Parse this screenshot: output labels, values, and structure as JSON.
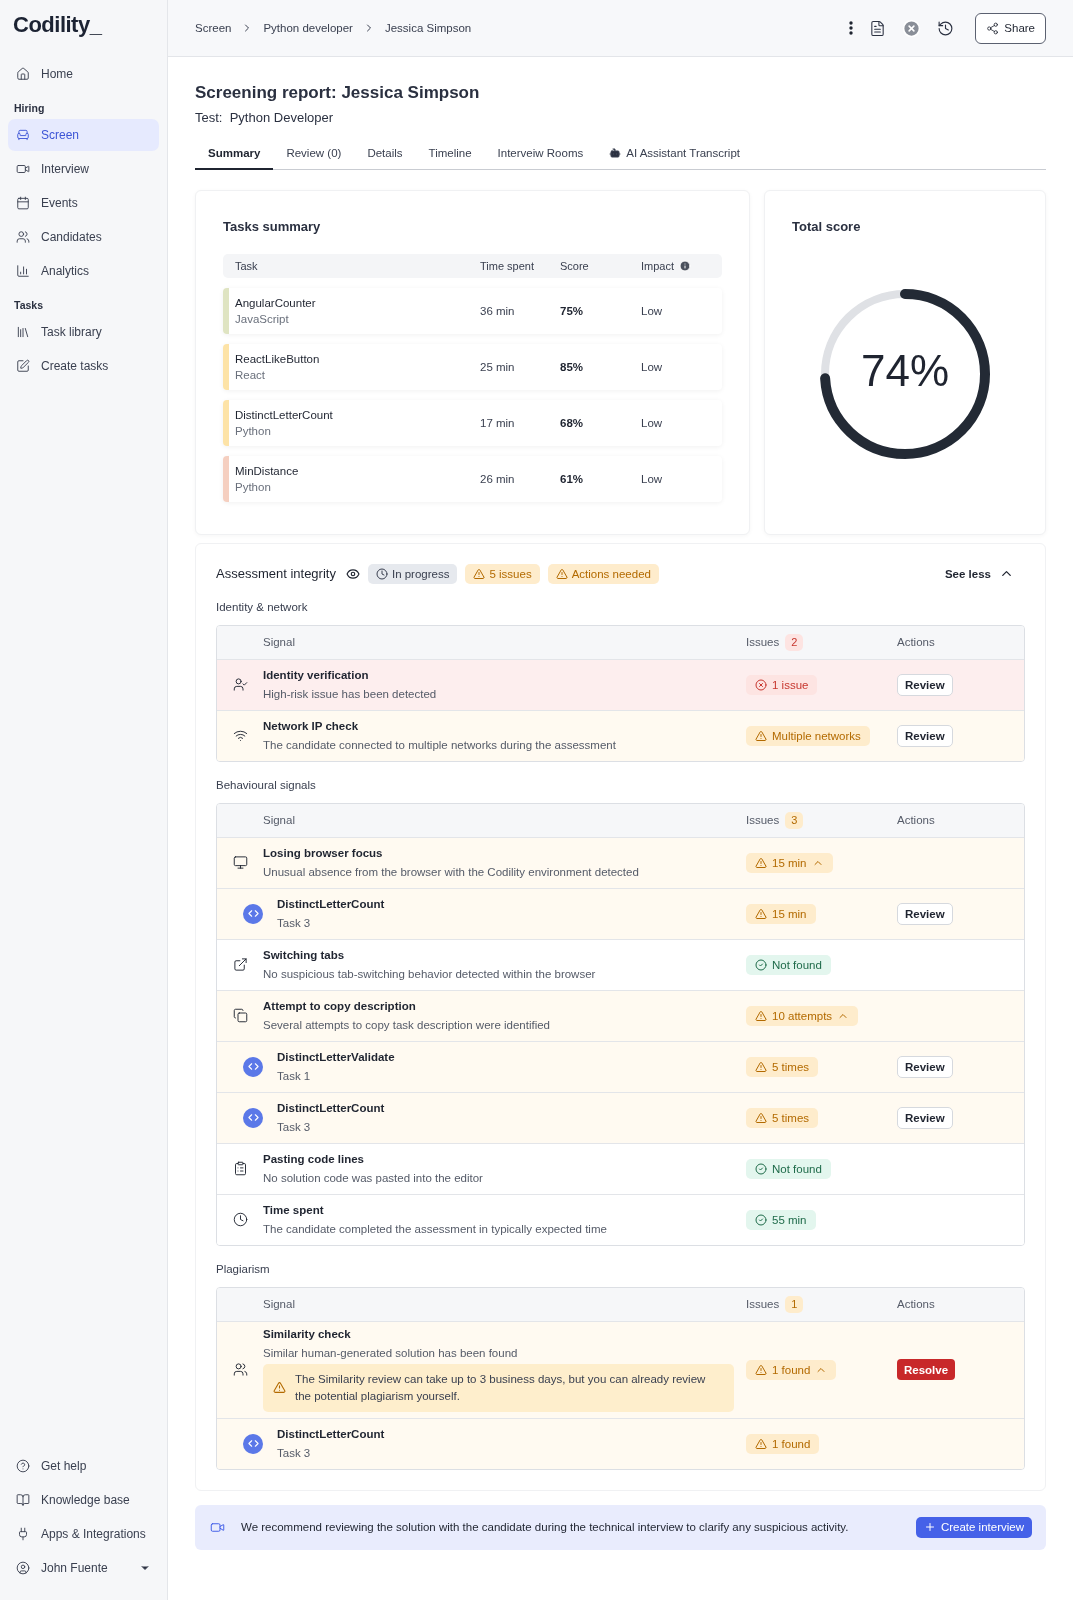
{
  "logo": "Codility_",
  "sidebar": {
    "top": [
      {
        "label": "Home",
        "selected": false
      }
    ],
    "sections": [
      {
        "title": "Hiring",
        "items": [
          {
            "label": "Screen",
            "selected": true
          },
          {
            "label": "Interview",
            "selected": false
          },
          {
            "label": "Events",
            "selected": false
          },
          {
            "label": "Candidates",
            "selected": false
          },
          {
            "label": "Analytics",
            "selected": false
          }
        ]
      },
      {
        "title": "Tasks",
        "items": [
          {
            "label": "Task library",
            "selected": false
          },
          {
            "label": "Create tasks",
            "selected": false
          }
        ]
      }
    ],
    "footer": [
      {
        "label": "Get help"
      },
      {
        "label": "Knowledge base"
      },
      {
        "label": "Apps & Integrations"
      }
    ],
    "user": "John Fuente"
  },
  "breadcrumbs": [
    "Screen",
    "Python developer",
    "Jessica Simpson"
  ],
  "share_button": "Share",
  "title": "Screening report: Jessica Simpson",
  "test": {
    "label": "Test:",
    "value": "Python Developer"
  },
  "tabs": [
    {
      "label": "Summary",
      "selected": true
    },
    {
      "label": "Review (0)",
      "selected": false
    },
    {
      "label": "Details",
      "selected": false
    },
    {
      "label": "Timeline",
      "selected": false
    },
    {
      "label": "Interveiw Rooms",
      "selected": false
    },
    {
      "label": "AI Assistant Transcript",
      "selected": false,
      "kind": "assistant"
    }
  ],
  "tasks_summary": {
    "title": "Tasks summary",
    "columns": [
      "Task",
      "Time spent",
      "Score",
      "Impact"
    ],
    "rows": [
      {
        "name": "AngularCounter",
        "language": "JavaScript",
        "time": "36 min",
        "score": "75%",
        "impact": "Low",
        "color": "#dfe4c2"
      },
      {
        "name": "ReactLikeButton",
        "language": "React",
        "time": "25 min",
        "score": "85%",
        "impact": "Low",
        "color": "#fde3a7"
      },
      {
        "name": "DistinctLetterCount",
        "language": "Python",
        "time": "17 min",
        "score": "68%",
        "impact": "Low",
        "color": "#fde3a7"
      },
      {
        "name": "MinDistance",
        "language": "Python",
        "time": "26 min",
        "score": "61%",
        "impact": "Low",
        "color": "#f5cfc0"
      }
    ]
  },
  "total_score": {
    "title": "Total score",
    "value": "74%",
    "level": 0.74
  },
  "integrity": {
    "title": "Assessment integrity",
    "badges": [
      {
        "kind": "neutral",
        "label": "In progress"
      },
      {
        "kind": "warning",
        "label": "5 issues"
      },
      {
        "kind": "warning",
        "label": "Actions needed"
      }
    ],
    "toggle": "See less",
    "groups": [
      {
        "title": "Identity & network",
        "columns": [
          "Signal",
          "Issues",
          "Actions"
        ],
        "issue_count": {
          "kind": "danger",
          "label": "2"
        },
        "rows": [
          {
            "kind": "signal",
            "title": "Identity verification",
            "subtitle": "High-risk issue has been detected",
            "status": {
              "kind": "danger",
              "label": "1 issue"
            },
            "action": {
              "kind": "review",
              "label": "Review"
            }
          },
          {
            "kind": "signal",
            "title": "Network IP check",
            "subtitle": "The candidate connected to multiple networks during the assessment",
            "status": {
              "kind": "warning",
              "label": "Multiple networks"
            },
            "action": {
              "kind": "review",
              "label": "Review"
            }
          }
        ]
      },
      {
        "title": "Behavioural signals",
        "columns": [
          "Signal",
          "Issues",
          "Actions"
        ],
        "issue_count": {
          "kind": "warning",
          "label": "3"
        },
        "rows": [
          {
            "kind": "signal",
            "title": "Losing browser focus",
            "subtitle": "Unusual absence from the browser with the Codility environment detected",
            "status": {
              "kind": "warning",
              "label": "15 min",
              "expanded": true
            }
          },
          {
            "kind": "task",
            "title": "DistinctLetterCount",
            "subtitle": "Task 3",
            "status": {
              "kind": "warning",
              "label": "15 min"
            },
            "action": {
              "kind": "review",
              "label": "Review"
            }
          },
          {
            "kind": "signal",
            "title": "Switching tabs",
            "subtitle": "No suspicious tab-switching behavior detected within the browser",
            "status": {
              "kind": "success",
              "label": "Not found"
            }
          },
          {
            "kind": "signal",
            "title": "Attempt to copy description",
            "subtitle": "Several attempts to copy task description were identified",
            "status": {
              "kind": "warning",
              "label": "10 attempts",
              "expanded": true
            }
          },
          {
            "kind": "task",
            "title": "DistinctLetterValidate",
            "subtitle": "Task 1",
            "status": {
              "kind": "warning",
              "label": "5 times"
            },
            "action": {
              "kind": "review",
              "label": "Review"
            }
          },
          {
            "kind": "task",
            "title": "DistinctLetterCount",
            "subtitle": "Task 3",
            "status": {
              "kind": "warning",
              "label": "5 times"
            },
            "action": {
              "kind": "review",
              "label": "Review"
            }
          },
          {
            "kind": "signal",
            "title": "Pasting code lines",
            "subtitle": "No solution code was pasted into the editor",
            "status": {
              "kind": "success",
              "label": "Not found"
            }
          },
          {
            "kind": "signal",
            "title": "Time spent",
            "subtitle": "The candidate completed the assessment in typically expected time",
            "status": {
              "kind": "success",
              "label": "55 min"
            }
          }
        ]
      },
      {
        "title": "Plagiarism",
        "columns": [
          "Signal",
          "Issues",
          "Actions"
        ],
        "issue_count": {
          "kind": "warning",
          "label": "1"
        },
        "rows": [
          {
            "kind": "signal",
            "title": "Similarity check",
            "subtitle": "Similar human-generated solution has been found",
            "note": "The Similarity review can take up to 3 business days, but you can already review the potential plagiarism yourself.",
            "status": {
              "kind": "warning",
              "label": "1 found",
              "expanded": true
            },
            "action": {
              "kind": "resolve",
              "label": "Resolve"
            }
          },
          {
            "kind": "task",
            "title": "DistinctLetterCount",
            "subtitle": "Task 3",
            "status": {
              "kind": "warning",
              "label": "1 found"
            }
          }
        ]
      }
    ]
  },
  "recommendation": {
    "text": "We recommend reviewing the solution with the candidate during the technical interview to clarify any suspicious activity.",
    "button": "Create interview"
  }
}
